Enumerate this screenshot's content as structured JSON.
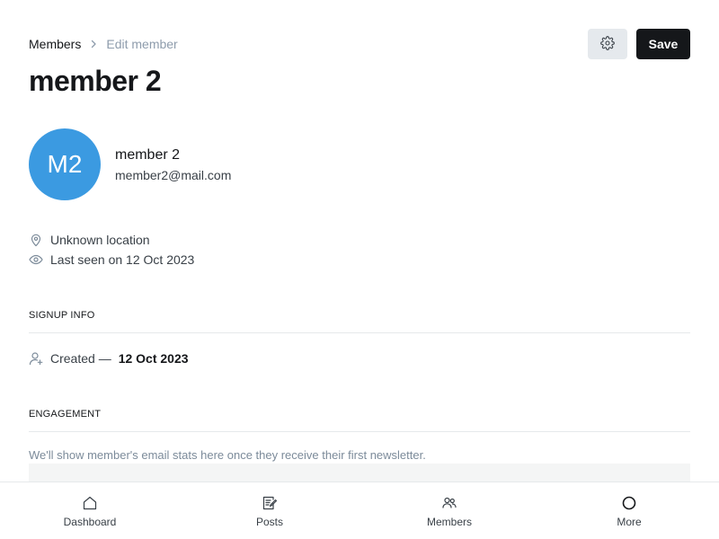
{
  "breadcrumb": {
    "parent": "Members",
    "current": "Edit member"
  },
  "header": {
    "title": "member 2",
    "settings_icon": "gear-icon",
    "save_label": "Save"
  },
  "member": {
    "initials": "M2",
    "name": "member 2",
    "email": "member2@mail.com",
    "avatar_color": "#3b9ae1",
    "location": "Unknown location",
    "last_seen": "Last seen on 12 Oct 2023"
  },
  "signup_info": {
    "heading": "SIGNUP INFO",
    "created_label": "Created —",
    "created_date": "12 Oct 2023"
  },
  "engagement": {
    "heading": "ENGAGEMENT",
    "note": "We'll show member's email stats here once they receive their first newsletter."
  },
  "bottom_nav": {
    "items": [
      {
        "label": "Dashboard",
        "icon": "home-icon"
      },
      {
        "label": "Posts",
        "icon": "posts-icon"
      },
      {
        "label": "Members",
        "icon": "members-icon"
      },
      {
        "label": "More",
        "icon": "more-circle-icon"
      }
    ]
  },
  "colors": {
    "primary_button": "#15171a",
    "secondary_button": "#e5e9ed",
    "muted_text": "#8e9cac"
  }
}
